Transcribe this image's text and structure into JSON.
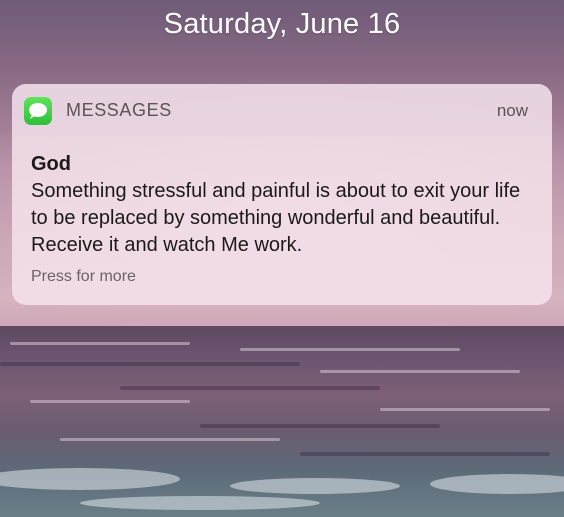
{
  "lock_screen": {
    "date": "Saturday, June 16"
  },
  "notification": {
    "app_icon": "messages-bubble-icon",
    "app_name": "MESSAGES",
    "timestamp": "now",
    "sender": "God",
    "body": "Something stressful and painful is about to exit your life to be replaced by something wonderful and beautiful. Receive it and watch Me work.",
    "action_hint": "Press for more"
  },
  "colors": {
    "messages_green": "#34c759",
    "notification_bg": "#f4e2ec",
    "date_text": "#ffffff"
  }
}
